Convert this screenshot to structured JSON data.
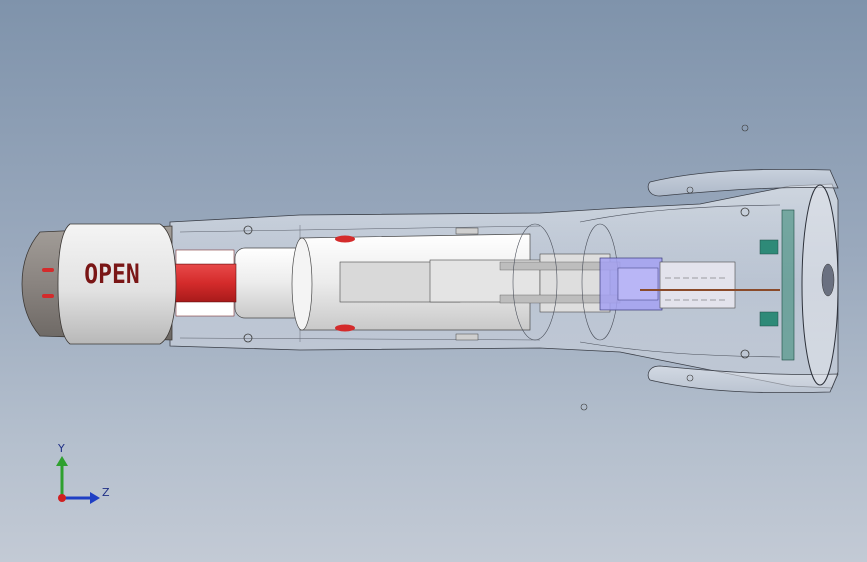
{
  "model": {
    "label_text": "OPEN",
    "description_name": "flashlight-assembly-section-view"
  },
  "triad": {
    "y_label": "Y",
    "z_label": "Z",
    "colors": {
      "y": "#2fa02f",
      "z": "#1f3fc4",
      "x": "#d02020"
    }
  },
  "colors": {
    "background_top": "#7f93ab",
    "background_bottom": "#c3cad5",
    "cap": "#8a8580",
    "red_part": "#d42b2b",
    "body_glass": "#e6e8ee",
    "lens_blue": "#9f9cf0",
    "pcb_green": "#2e8a78"
  }
}
